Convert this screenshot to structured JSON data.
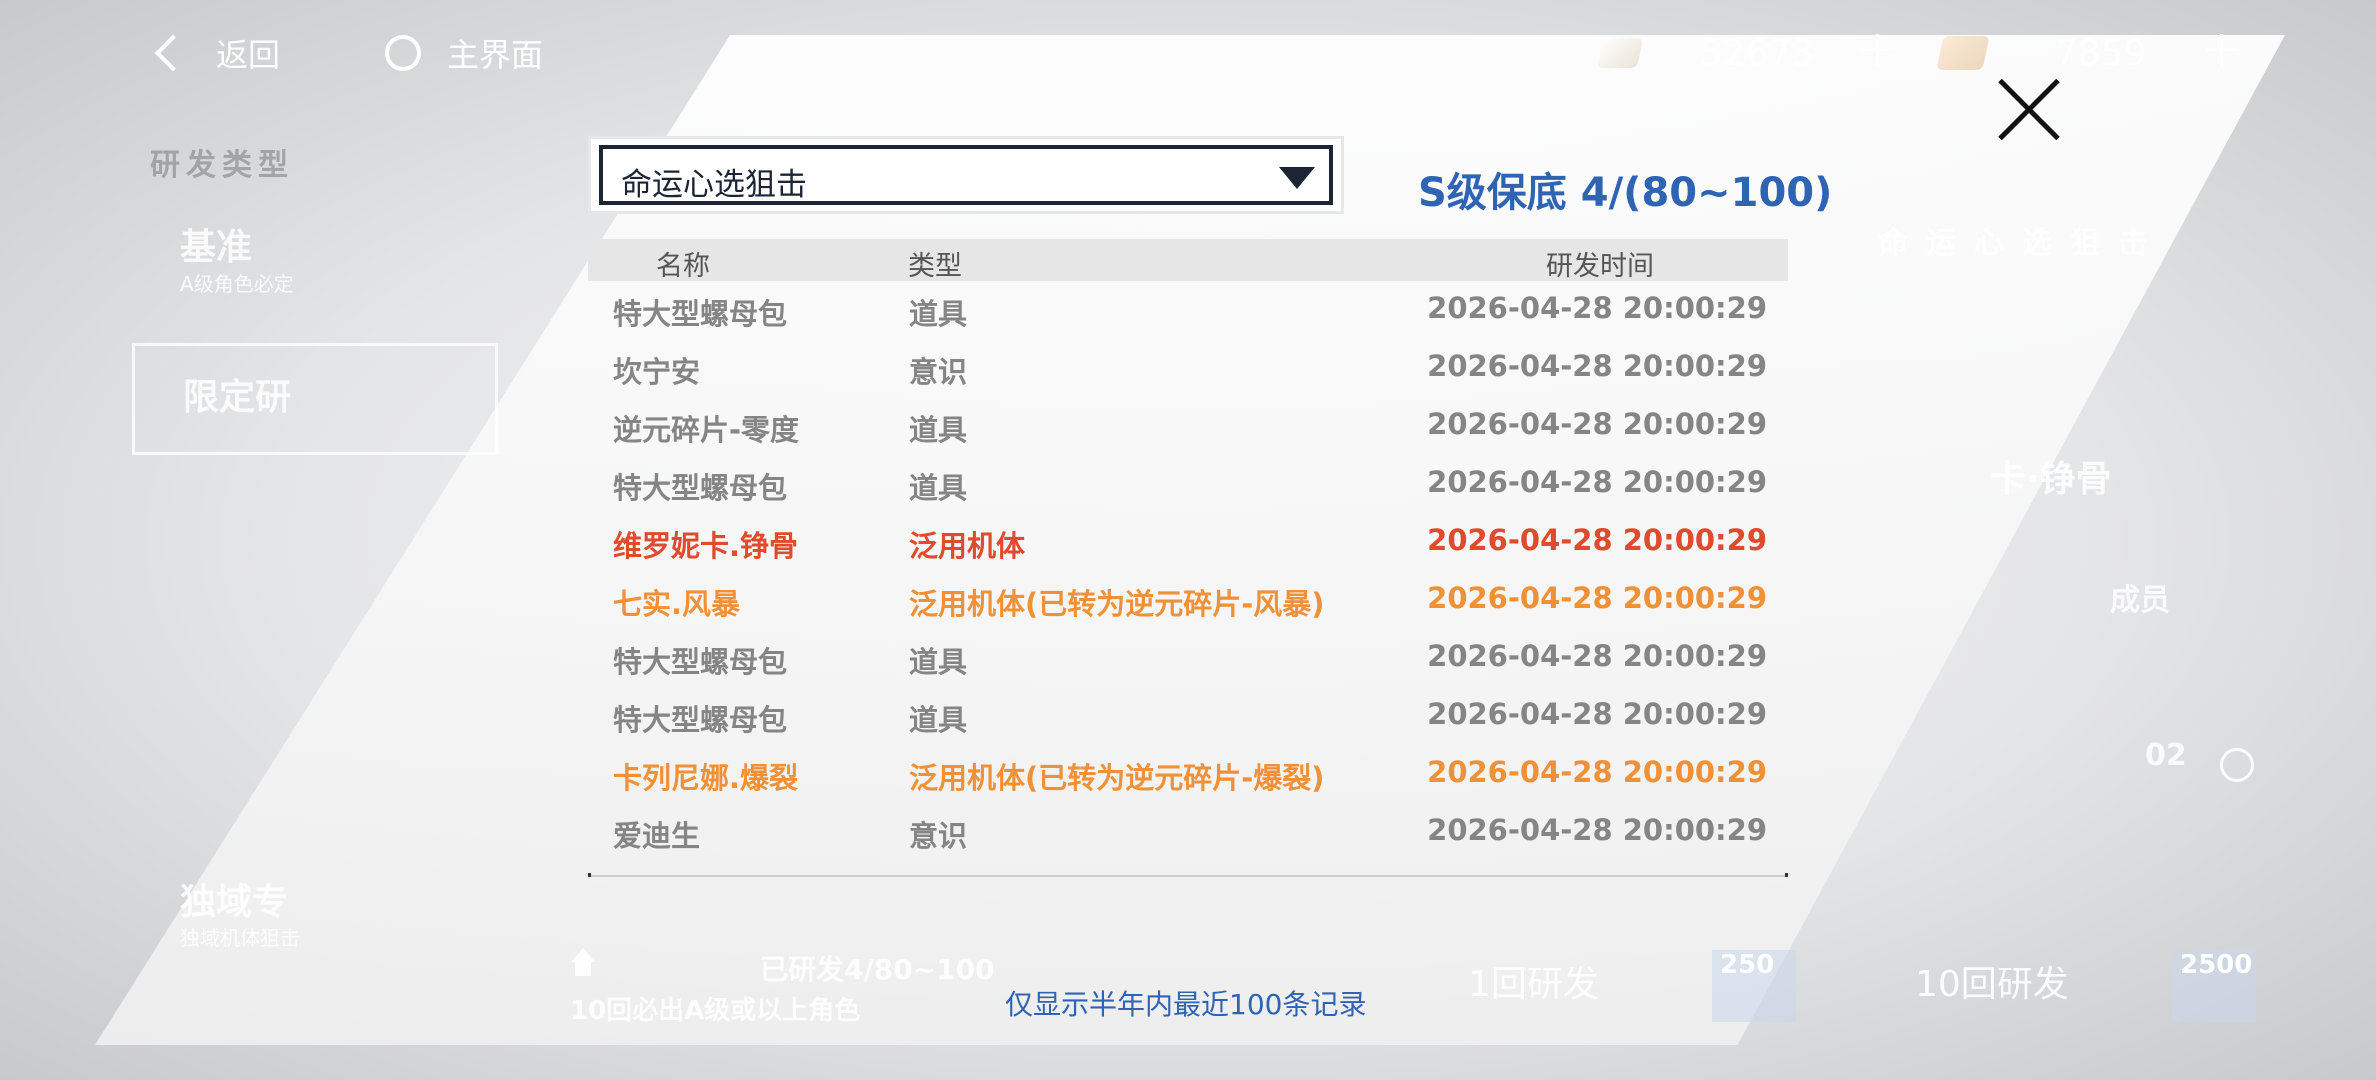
{
  "nav": {
    "back_label": "返回",
    "home_label": "主界面"
  },
  "currency": [
    {
      "icon": "pen-currency-icon",
      "amount": "52673"
    },
    {
      "icon": "ticket-currency-icon",
      "amount": "7859"
    }
  ],
  "background": {
    "category_title": "研发类型",
    "standard_label": "基准",
    "standard_sub": "A级角色必定",
    "limited_label": "限定研",
    "banner_title": "命运心选狙击",
    "featured_name": "卡·铮骨",
    "right_note": "成员",
    "timer_partial": "02",
    "domain_label": "独域专",
    "domain_sub": "独域机体狙击",
    "progress_text": "已研发4/80~100",
    "guarantee_text": "10回必出A级或以上角色",
    "pull_1_label": "1回研发",
    "pull_1_cost": "250",
    "pull_10_label": "10回研发",
    "pull_10_cost": "2500"
  },
  "dialog": {
    "pool_select_value": "命运心选狙击",
    "pity_text": "S级保底 4/(80~100)",
    "columns": {
      "name": "名称",
      "type": "类型",
      "time": "研发时间"
    },
    "rows": [
      {
        "name": "特大型螺母包",
        "type": "道具",
        "time": "2026-04-28 20:00:29",
        "rarity": "grey"
      },
      {
        "name": "坎宁安",
        "type": "意识",
        "time": "2026-04-28 20:00:29",
        "rarity": "grey"
      },
      {
        "name": "逆元碎片-零度",
        "type": "道具",
        "time": "2026-04-28 20:00:29",
        "rarity": "grey"
      },
      {
        "name": "特大型螺母包",
        "type": "道具",
        "time": "2026-04-28 20:00:29",
        "rarity": "grey"
      },
      {
        "name": "维罗妮卡.铮骨",
        "type": "泛用机体",
        "time": "2026-04-28 20:00:29",
        "rarity": "red"
      },
      {
        "name": "七实.风暴",
        "type": "泛用机体(已转为逆元碎片-风暴)",
        "time": "2026-04-28 20:00:29",
        "rarity": "orange"
      },
      {
        "name": "特大型螺母包",
        "type": "道具",
        "time": "2026-04-28 20:00:29",
        "rarity": "grey"
      },
      {
        "name": "特大型螺母包",
        "type": "道具",
        "time": "2026-04-28 20:00:29",
        "rarity": "grey"
      },
      {
        "name": "卡列尼娜.爆裂",
        "type": "泛用机体(已转为逆元碎片-爆裂)",
        "time": "2026-04-28 20:00:29",
        "rarity": "orange"
      },
      {
        "name": "爱迪生",
        "type": "意识",
        "time": "2026-04-28 20:00:29",
        "rarity": "grey"
      }
    ],
    "footnote": "仅显示半年内最近100条记录"
  },
  "colors": {
    "grey": "#858585",
    "red": "#e04a2d",
    "orange": "#f09138",
    "accent_blue": "#2e64b3"
  }
}
